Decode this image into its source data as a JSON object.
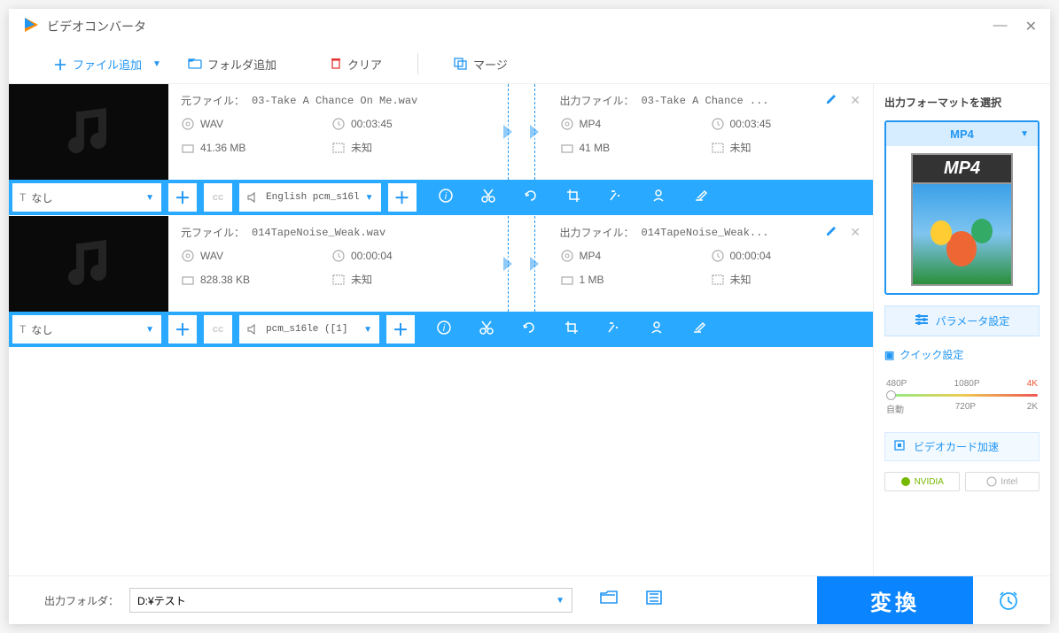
{
  "app": {
    "title": "ビデオコンバータ"
  },
  "toolbar": {
    "add_file": "ファイル追加",
    "add_folder": "フォルダ追加",
    "clear": "クリア",
    "merge": "マージ"
  },
  "labels": {
    "source": "元ファイル：",
    "output": "出力ファイル：",
    "subtitle_none": "なし"
  },
  "items": [
    {
      "src_name": "03-Take A Chance On Me.wav",
      "out_name": "03-Take A Chance ...",
      "src_fmt": "WAV",
      "src_dur": "00:03:45",
      "src_size": "41.36 MB",
      "src_res": "未知",
      "out_fmt": "MP4",
      "out_dur": "00:03:45",
      "out_size": "41 MB",
      "out_res": "未知",
      "audio": "English pcm_s16l"
    },
    {
      "src_name": "014TapeNoise_Weak.wav",
      "out_name": "014TapeNoise_Weak...",
      "src_fmt": "WAV",
      "src_dur": "00:00:04",
      "src_size": "828.38 KB",
      "src_res": "未知",
      "out_fmt": "MP4",
      "out_dur": "00:00:04",
      "out_size": "1 MB",
      "out_res": "未知",
      "audio": "pcm_s16le ([1]"
    }
  ],
  "sidebar": {
    "title": "出力フォーマットを選択",
    "format": "MP4",
    "preview_label": "MP4",
    "param_btn": "パラメータ設定",
    "quick_title": "クイック設定",
    "quality": {
      "r1a": "480P",
      "r1b": "1080P",
      "r1c": "4K",
      "r2a": "自動",
      "r2b": "720P",
      "r2c": "2K"
    },
    "gpu": "ビデオカード加速",
    "nvidia": "NVIDIA",
    "intel": "Intel"
  },
  "footer": {
    "label": "出力フォルダ：",
    "path": "D:¥テスト",
    "convert": "変換"
  }
}
